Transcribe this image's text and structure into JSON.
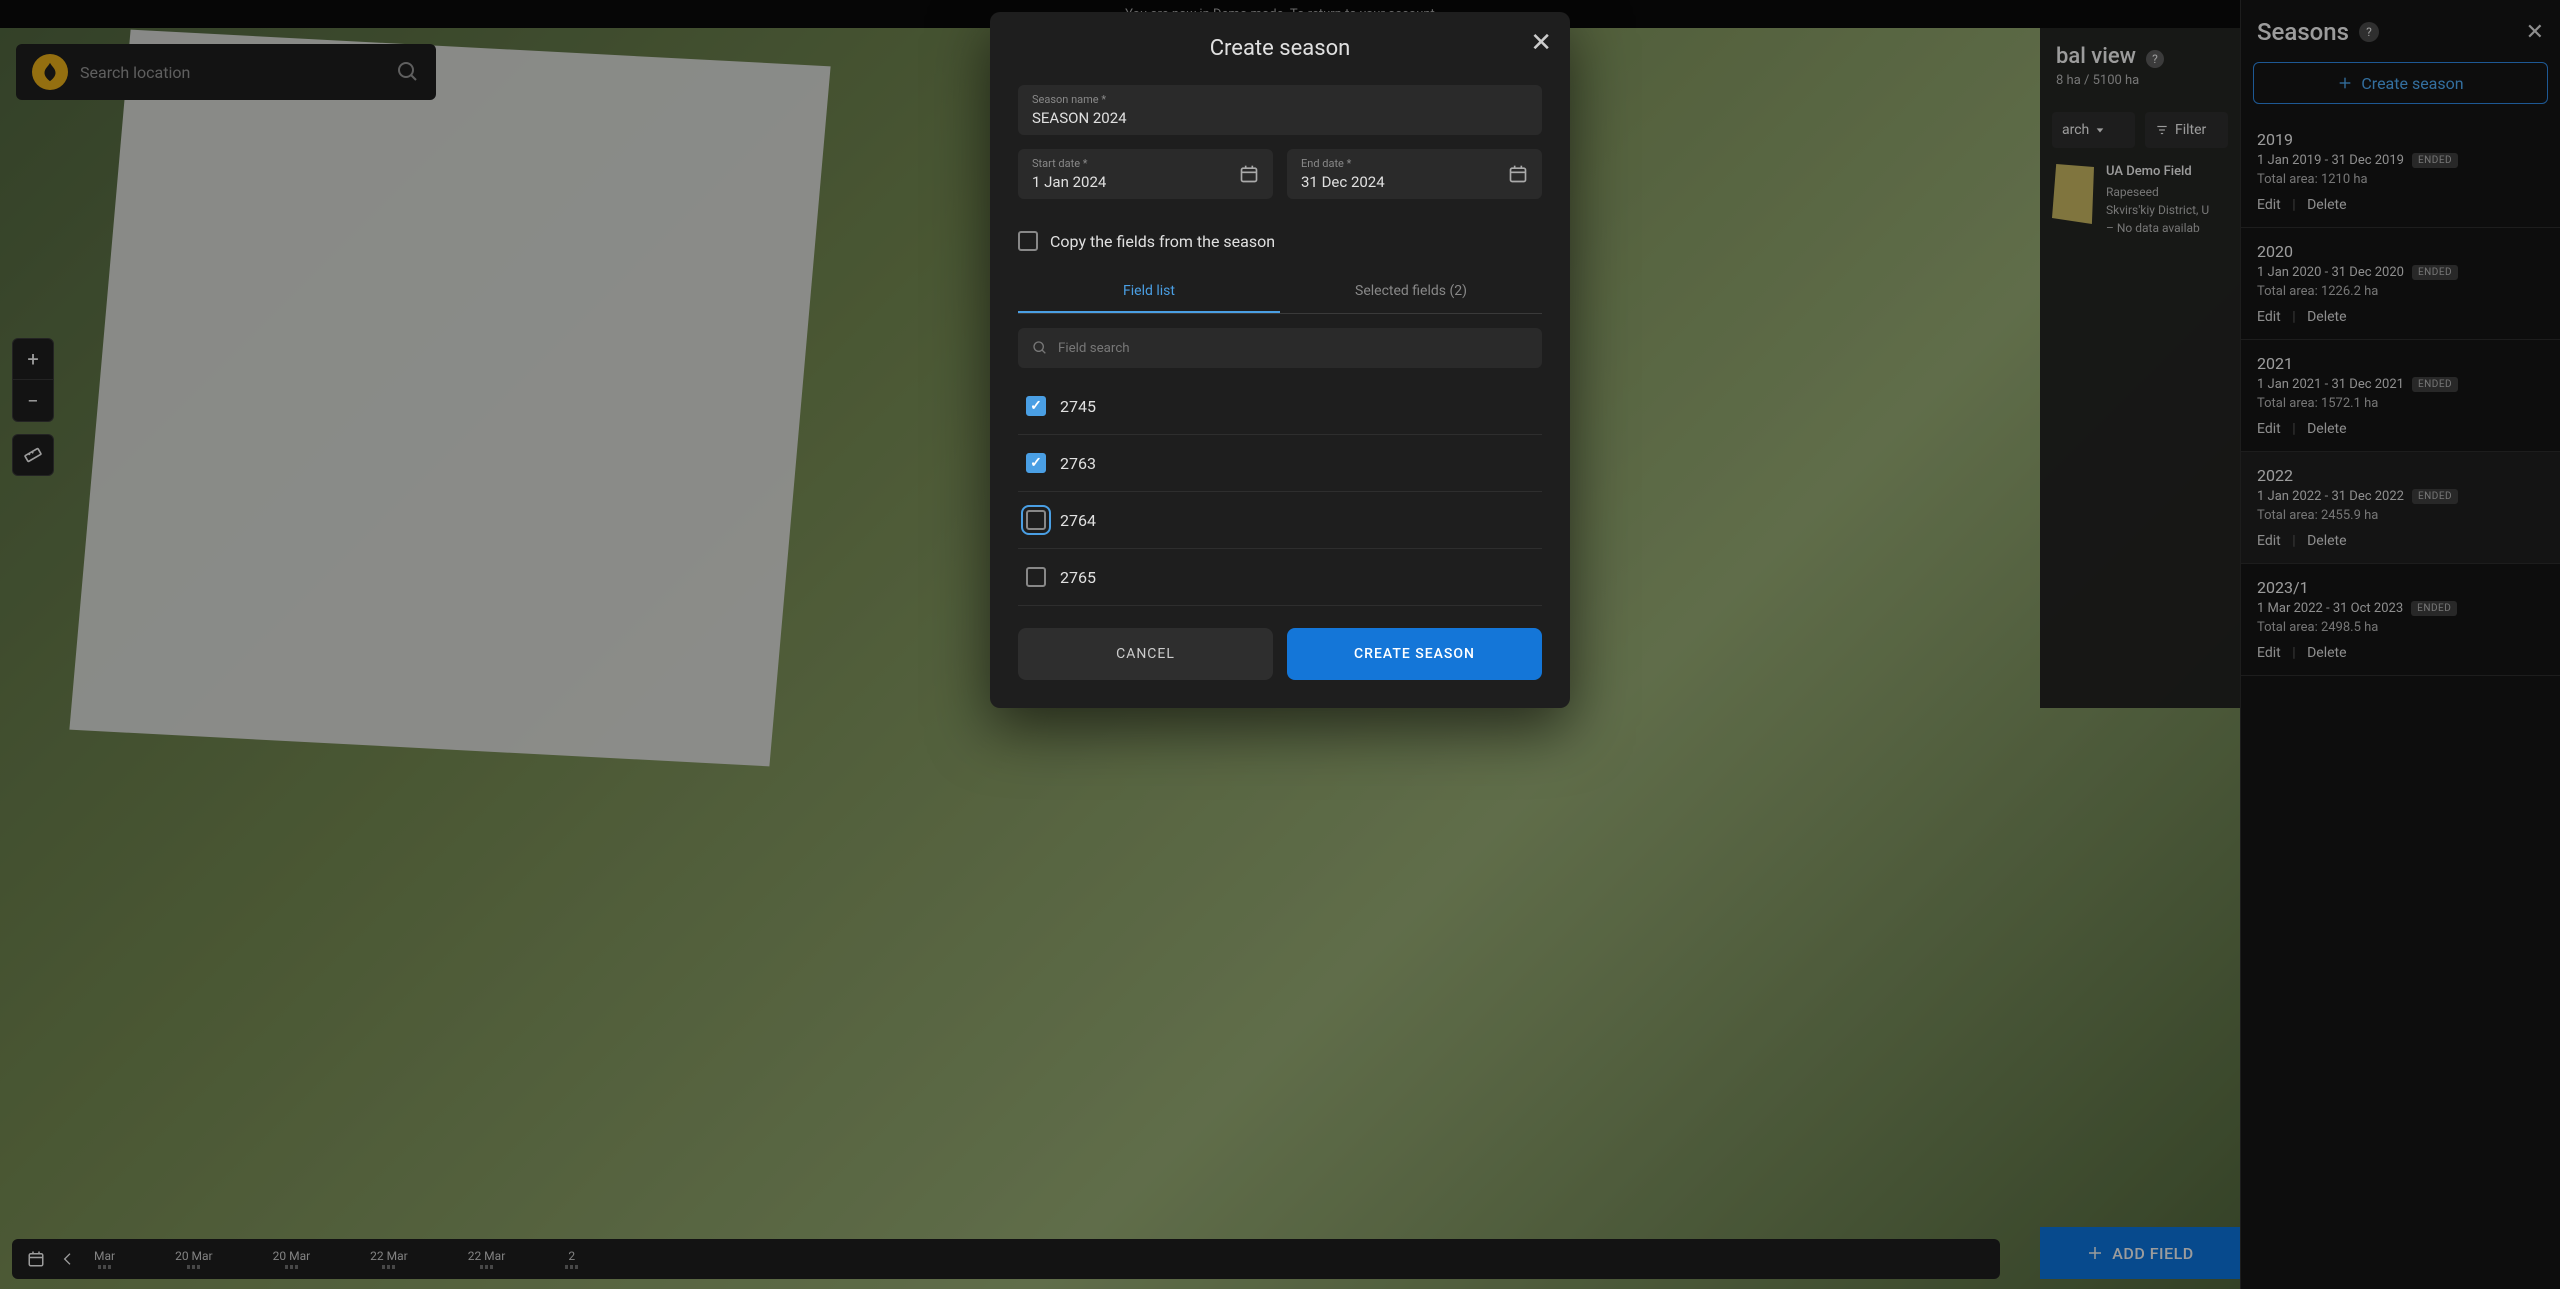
{
  "top_banner": "You are now in Demo mode. To return to your account",
  "search": {
    "placeholder": "Search location"
  },
  "global_view": {
    "title": "bal view",
    "sub": "8 ha / 5100 ha",
    "search_btn": "arch",
    "filter_btn": "Filter",
    "field": {
      "name": "UA Demo Field",
      "crop": "Rapeseed",
      "location": "Skvirs'kiy District, U",
      "nodata": "–  No data availab"
    }
  },
  "add_field": "Add Field",
  "timeline": {
    "dates": [
      "Mar",
      "20 Mar",
      "20 Mar",
      "22 Mar",
      "22 Mar",
      "2"
    ]
  },
  "seasons_panel": {
    "title": "Seasons",
    "create": "Create season",
    "items": [
      {
        "year": "2019",
        "range": "1 Jan 2019 - 31 Dec 2019",
        "badge": "ENDED",
        "area": "Total area: 1210 ha"
      },
      {
        "year": "2020",
        "range": "1 Jan 2020 - 31 Dec 2020",
        "badge": "ENDED",
        "area": "Total area: 1226.2 ha"
      },
      {
        "year": "2021",
        "range": "1 Jan 2021 - 31 Dec 2021",
        "badge": "ENDED",
        "area": "Total area: 1572.1 ha"
      },
      {
        "year": "2022",
        "range": "1 Jan 2022 - 31 Dec 2022",
        "badge": "ENDED",
        "area": "Total area: 2455.9 ha"
      },
      {
        "year": "2023/1",
        "range": "1 Mar 2022 - 31 Oct 2023",
        "badge": "ENDED",
        "area": "Total area: 2498.5 ha"
      }
    ],
    "edit": "Edit",
    "delete": "Delete"
  },
  "modal": {
    "title": "Create season",
    "name_label": "Season name *",
    "name_value": "SEASON 2024",
    "start_label": "Start date *",
    "start_value": "1 Jan 2024",
    "end_label": "End date *",
    "end_value": "31 Dec 2024",
    "copy_label": "Copy the fields from the season",
    "tab_list": "Field list",
    "tab_selected": "Selected fields (2)",
    "field_search_placeholder": "Field search",
    "fields": [
      {
        "id": "2745",
        "checked": true,
        "focus": false
      },
      {
        "id": "2763",
        "checked": true,
        "focus": false
      },
      {
        "id": "2764",
        "checked": false,
        "focus": true
      },
      {
        "id": "2765",
        "checked": false,
        "focus": false
      }
    ],
    "cancel": "Cancel",
    "create": "Create season"
  }
}
